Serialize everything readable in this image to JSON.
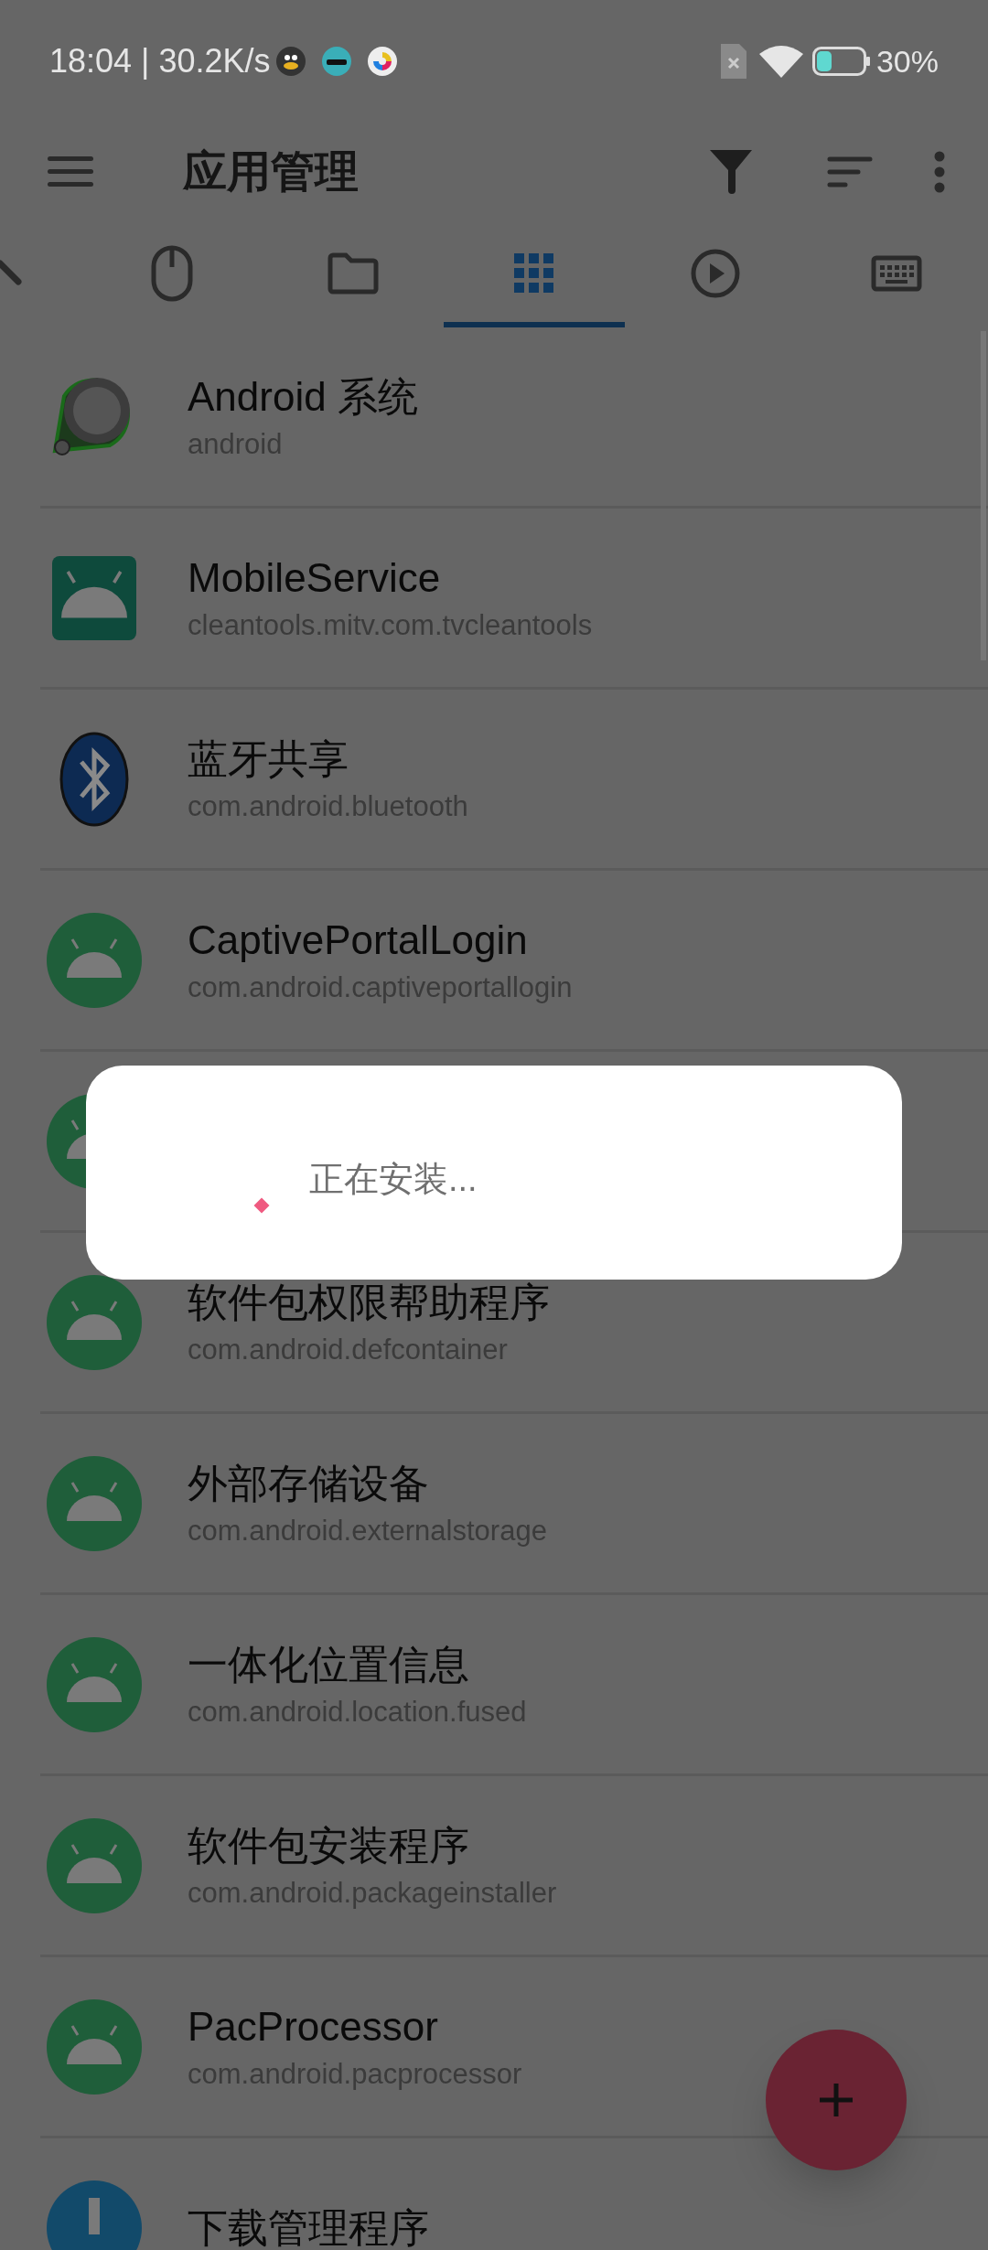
{
  "status_bar": {
    "time": "18:04",
    "speed": "| 30.2K/s",
    "battery": "30%"
  },
  "toolbar": {
    "title": "应用管理"
  },
  "tabs": [
    {
      "kind": "pencil",
      "selected": false
    },
    {
      "kind": "mouse",
      "selected": false
    },
    {
      "kind": "folder",
      "selected": false
    },
    {
      "kind": "grid",
      "selected": true
    },
    {
      "kind": "play",
      "selected": false
    },
    {
      "kind": "keyboard",
      "selected": false
    }
  ],
  "apps": [
    {
      "kind": "system",
      "name": "Android 系统",
      "package": "android"
    },
    {
      "kind": "square",
      "name": "MobileService",
      "package": "cleantools.mitv.com.tvcleantools"
    },
    {
      "kind": "bluetooth",
      "name": "蓝牙共享",
      "package": "com.android.bluetooth"
    },
    {
      "kind": "round",
      "name": "CaptivePortalLogin",
      "package": "com.android.captiveportallogin"
    },
    {
      "kind": "round"
    },
    {
      "kind": "round",
      "name": "软件包权限帮助程序",
      "package": "com.android.defcontainer"
    },
    {
      "kind": "round",
      "name": "外部存储设备",
      "package": "com.android.externalstorage"
    },
    {
      "kind": "round",
      "name": "一体化位置信息",
      "package": "com.android.location.fused"
    },
    {
      "kind": "round",
      "name": "软件包安装程序",
      "package": "com.android.packageinstaller"
    },
    {
      "kind": "round",
      "name": "PacProcessor",
      "package": "com.android.pacprocessor"
    },
    {
      "kind": "download",
      "name": "下载管理程序"
    }
  ],
  "dialog": {
    "message": "正在安装..."
  }
}
